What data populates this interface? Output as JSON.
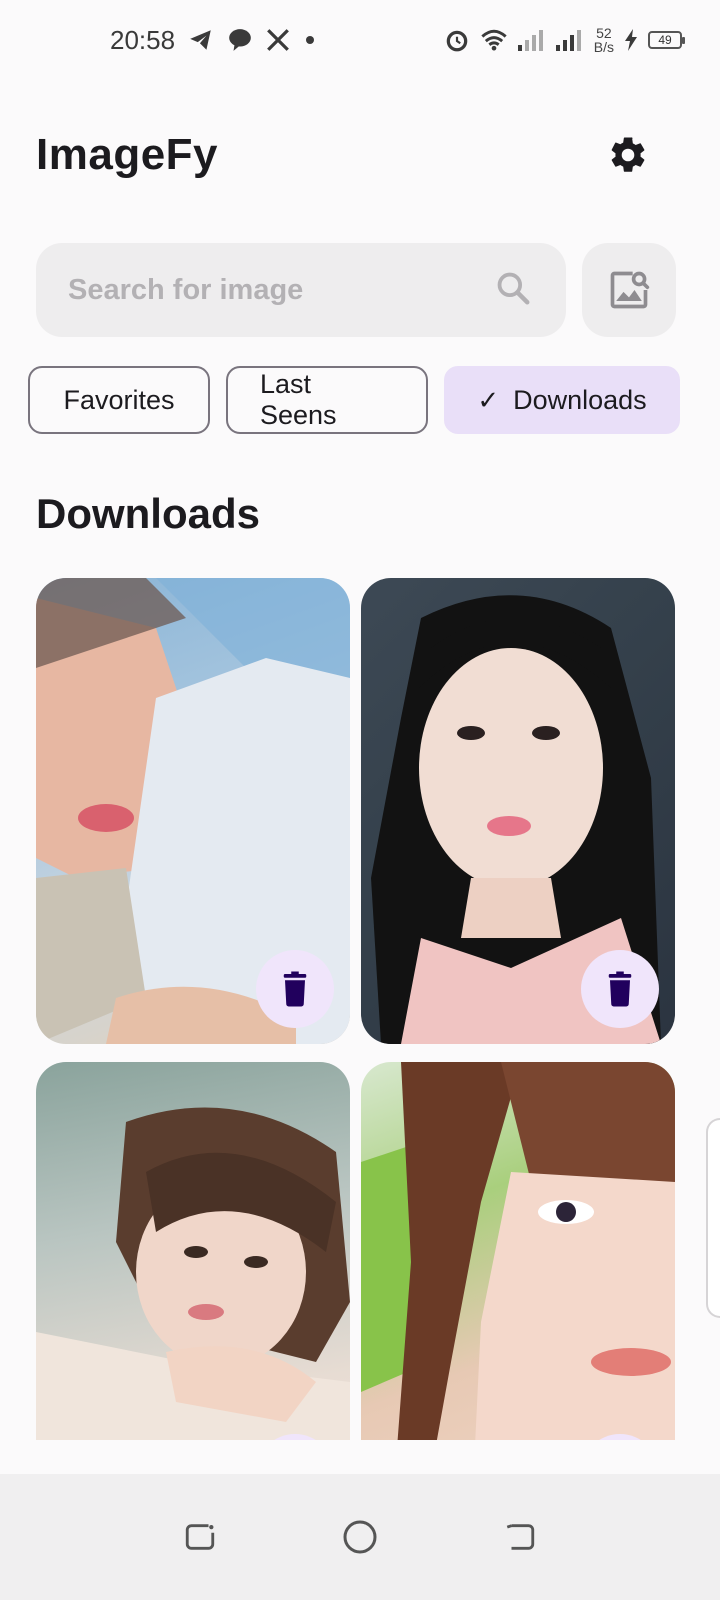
{
  "status_bar": {
    "time": "20:58",
    "left_icons": [
      "telegram-icon",
      "chat-bubble-icon",
      "x-icon",
      "dot-icon"
    ],
    "net_speed_value": "52",
    "net_speed_unit": "B/s",
    "battery": "49"
  },
  "header": {
    "title": "ImageFy",
    "settings_icon": "gear-icon"
  },
  "search": {
    "placeholder": "Search for image",
    "value": "",
    "search_icon": "search-icon",
    "image_search_icon": "image-search-icon"
  },
  "chips": [
    {
      "label": "Favorites",
      "selected": false
    },
    {
      "label": "Last Seens",
      "selected": false
    },
    {
      "label": "Downloads",
      "selected": true
    }
  ],
  "section": {
    "title": "Downloads"
  },
  "images": [
    {
      "name": "downloaded-image-1",
      "delete_icon": "trash-icon"
    },
    {
      "name": "downloaded-image-2",
      "delete_icon": "trash-icon"
    },
    {
      "name": "downloaded-image-3",
      "delete_icon": "trash-icon"
    },
    {
      "name": "downloaded-image-4",
      "delete_icon": "trash-icon"
    }
  ],
  "nav_bar": {
    "buttons": [
      "recents-icon",
      "home-icon",
      "back-icon"
    ]
  },
  "colors": {
    "background": "#fbfafb",
    "chip_selected": "#e9dff8",
    "delete_button": "#f0e5fb",
    "delete_icon": "#21005d"
  }
}
